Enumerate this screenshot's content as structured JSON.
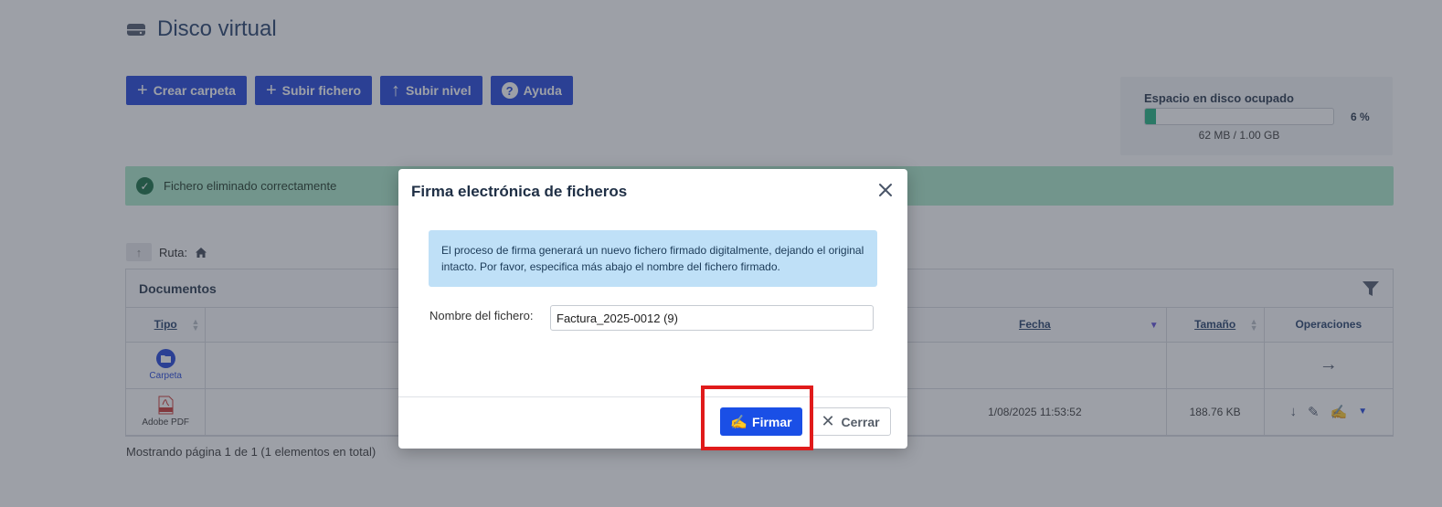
{
  "page": {
    "title": "Disco virtual"
  },
  "toolbar": {
    "create_folder": "Crear carpeta",
    "upload_file": "Subir fichero",
    "level_up": "Subir nivel",
    "help": "Ayuda"
  },
  "disk": {
    "label": "Espacio en disco ocupado",
    "percent": "6 %",
    "percent_value": 6,
    "usage": "62 MB / 1.00 GB",
    "fill_color": "#1bb07c"
  },
  "alert": {
    "message": "Fichero eliminado correctamente",
    "color": "#a8e9c8"
  },
  "path": {
    "label": "Ruta:"
  },
  "table": {
    "title": "Documentos",
    "columns": [
      "Tipo",
      "Fecha",
      "Tamaño",
      "Operaciones"
    ],
    "rows": [
      {
        "type": "Carpeta",
        "date": "",
        "size": ""
      },
      {
        "type": "Adobe PDF",
        "date": "1/08/2025 11:53:52",
        "size": "188.76 KB"
      }
    ]
  },
  "footer": {
    "pagination": "Mostrando página 1 de 1 (1 elementos en total)"
  },
  "modal": {
    "title": "Firma electrónica de ficheros",
    "info": "El proceso de firma generará un nuevo fichero firmado digitalmente, dejando el original intacto. Por favor, especifica más abajo el nombre del fichero firmado.",
    "field_label": "Nombre del fichero:",
    "field_value": "Factura_2025-0012 (9)",
    "sign_button": "Firmar",
    "close_button": "Cerrar"
  },
  "colors": {
    "primary": "#1a3fd9",
    "highlight": "#e01b1b"
  }
}
